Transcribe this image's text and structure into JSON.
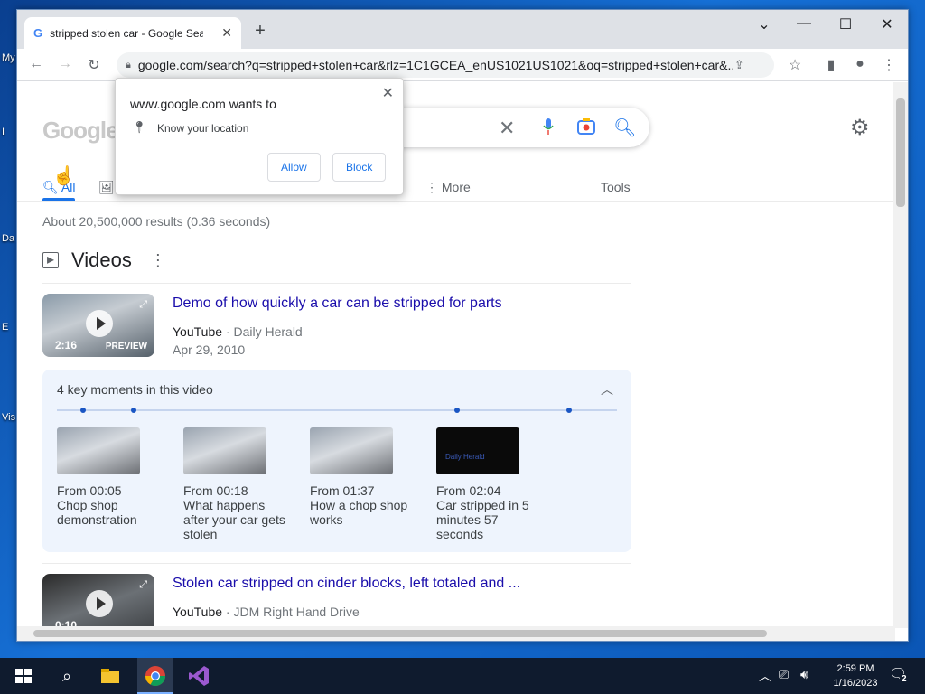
{
  "desktop": {
    "labels": [
      "My",
      "I",
      "Da",
      "E",
      "Vis"
    ]
  },
  "browser": {
    "tab_title": "stripped stolen car - Google Sear",
    "url": "google.com/search?q=stripped+stolen+car&rlz=1C1GCEA_enUS1021US1021&oq=stripped+stolen+car&..."
  },
  "popup": {
    "title": "www.google.com wants to",
    "permission": "Know your location",
    "allow_label": "Allow",
    "block_label": "Block"
  },
  "search": {
    "nav": {
      "all": "All",
      "more": "More",
      "tools": "Tools"
    },
    "stats": "About 20,500,000 results (0.36 seconds)"
  },
  "videos": {
    "section_title": "Videos",
    "items": [
      {
        "title": "Demo of how quickly a car can be stripped for parts",
        "source": "YouTube",
        "channel": "Daily Herald",
        "date": "Apr 29, 2010",
        "duration": "2:16",
        "badge": "PREVIEW"
      },
      {
        "title": "Stolen car stripped on cinder blocks, left totaled and ...",
        "source": "YouTube",
        "channel": "JDM Right Hand Drive",
        "date": "",
        "duration": "0:10"
      }
    ],
    "key_moments": {
      "header": "4 key moments in this video",
      "moments": [
        {
          "from": "From 00:05",
          "label": "Chop shop demonstration"
        },
        {
          "from": "From 00:18",
          "label": "What happens after your car gets stolen"
        },
        {
          "from": "From 01:37",
          "label": "How a chop shop works"
        },
        {
          "from": "From 02:04",
          "label": "Car stripped in 5 minutes 57 seconds"
        }
      ],
      "logo_text": "Daily Herald"
    }
  },
  "taskbar": {
    "time": "2:59 PM",
    "date": "1/16/2023",
    "notifications": "2"
  },
  "colors": {
    "link": "#1a0dab",
    "accent": "#1a73e8"
  }
}
